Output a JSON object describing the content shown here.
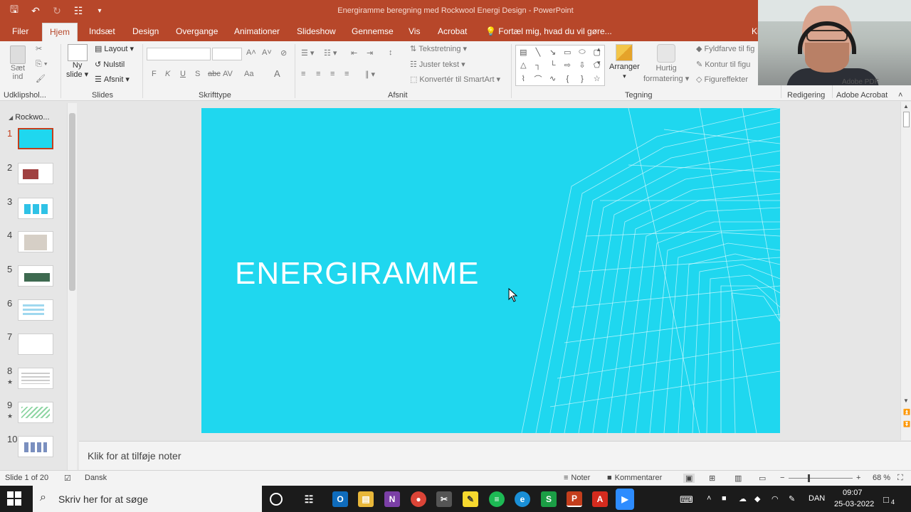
{
  "window": {
    "title": "Energiramme beregning med Rockwool Energi Design  -  PowerPoint",
    "user_initials": "Ki"
  },
  "tabs": [
    "Filer",
    "Hjem",
    "Indsæt",
    "Design",
    "Overgange",
    "Animationer",
    "Slideshow",
    "Gennemse",
    "Vis",
    "Acrobat"
  ],
  "active_tab": "Hjem",
  "tell_me": "Fortæl mig, hvad du vil gøre...",
  "ribbon": {
    "clipboard": {
      "paste_line1": "Sæt",
      "paste_line2": "ind",
      "label": "Udklipshol..."
    },
    "slides": {
      "new_line1": "Ny",
      "new_line2": "slide",
      "layout": "Layout",
      "reset": "Nulstil",
      "section": "Afsnit",
      "label": "Slides"
    },
    "font": {
      "label": "Skrifttype",
      "buttons": [
        "F",
        "K",
        "U",
        "S",
        "abc",
        "AV",
        "Aa",
        "A"
      ]
    },
    "paragraph": {
      "text_direction": "Tekstretning",
      "align_text": "Juster tekst",
      "smartart": "Konvertér til SmartArt",
      "label": "Afsnit"
    },
    "drawing": {
      "arrange": "Arranger",
      "quick_line1": "Hurtig",
      "quick_line2": "formatering",
      "fill": "Fyldfarve til fig",
      "outline": "Kontur til figu",
      "effects": "Figureffekter",
      "label": "Tegning"
    },
    "editing": {
      "label": "Redigering"
    },
    "acrobat": {
      "label": "Adobe Acrobat",
      "pdf": "Adobe PDF"
    }
  },
  "slide_panel": {
    "section": "Rockwo...",
    "slides": [
      {
        "num": "1",
        "star": false
      },
      {
        "num": "2",
        "star": false
      },
      {
        "num": "3",
        "star": false
      },
      {
        "num": "4",
        "star": false
      },
      {
        "num": "5",
        "star": false
      },
      {
        "num": "6",
        "star": false
      },
      {
        "num": "7",
        "star": false
      },
      {
        "num": "8",
        "star": true
      },
      {
        "num": "9",
        "star": true
      },
      {
        "num": "10",
        "star": false
      }
    ]
  },
  "slide": {
    "title": "ENERGIRAMME",
    "background": "#1fd7ef"
  },
  "notes_placeholder": "Klik for at tilføje noter",
  "status": {
    "slide_of": "Slide 1 of 20",
    "language": "Dansk",
    "notes": "Noter",
    "comments": "Kommentarer",
    "zoom": "68 %"
  },
  "taskbar": {
    "search_placeholder": "Skriv her for at søge",
    "lang": "DAN",
    "time": "09:07",
    "date": "25-03-2022",
    "notification_count": "4"
  },
  "colors": {
    "accent": "#b7472a",
    "slide_bg": "#1fd7ef"
  }
}
